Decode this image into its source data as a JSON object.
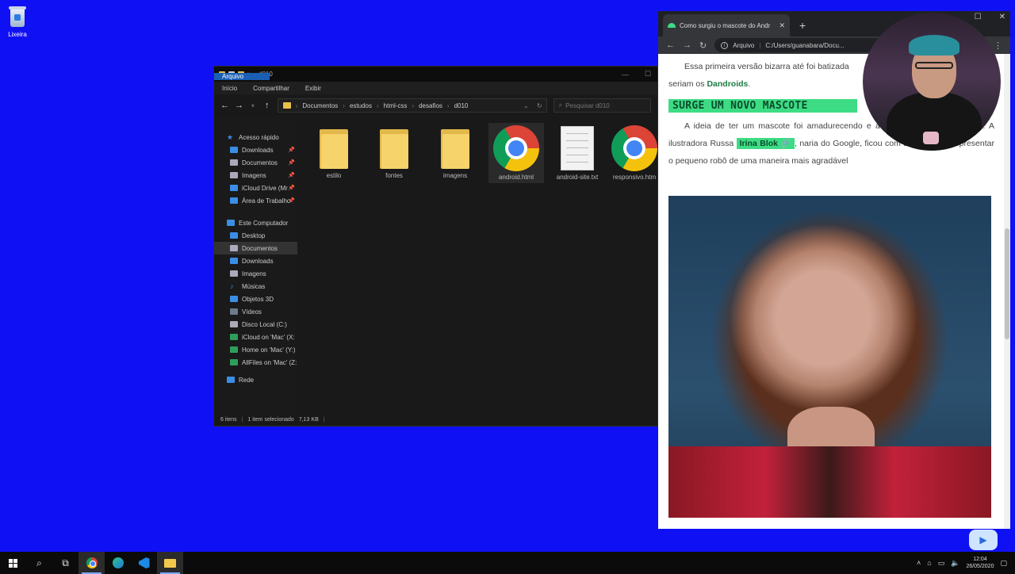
{
  "desktop": {
    "recycle_bin_label": "Lixeira"
  },
  "explorer": {
    "title": "d010",
    "menu": [
      "Arquivo",
      "Início",
      "Compartilhar",
      "Exibir"
    ],
    "breadcrumb": [
      "Documentos",
      "estudos",
      "html-css",
      "desafios",
      "d010"
    ],
    "search_placeholder": "Pesquisar d010",
    "quick_access_label": "Acesso rápido",
    "quick_access": [
      {
        "label": "Downloads",
        "icon": "download-icon"
      },
      {
        "label": "Documentos",
        "icon": "document-icon"
      },
      {
        "label": "Imagens",
        "icon": "image-icon"
      },
      {
        "label": "iCloud Drive (Mr",
        "icon": "cloud-icon"
      },
      {
        "label": "Área de Trabalho",
        "icon": "desktop-icon"
      }
    ],
    "this_pc_label": "Este Computador",
    "this_pc": [
      {
        "label": "Desktop"
      },
      {
        "label": "Documentos"
      },
      {
        "label": "Downloads"
      },
      {
        "label": "Imagens"
      },
      {
        "label": "Músicas"
      },
      {
        "label": "Objetos 3D"
      },
      {
        "label": "Vídeos"
      },
      {
        "label": "Disco Local (C:)"
      },
      {
        "label": "iCloud on 'Mac' (X:"
      },
      {
        "label": "Home on 'Mac' (Y:)"
      },
      {
        "label": "AllFiles on 'Mac' (Z:"
      }
    ],
    "network_label": "Rede",
    "files": [
      {
        "name": "estilo",
        "type": "folder"
      },
      {
        "name": "fontes",
        "type": "folder"
      },
      {
        "name": "imagens",
        "type": "folder"
      },
      {
        "name": "android.html",
        "type": "chrome",
        "selected": true
      },
      {
        "name": "android-site.txt",
        "type": "text"
      },
      {
        "name": "responsivo.htm",
        "type": "chrome"
      }
    ],
    "status": {
      "count": "6 itens",
      "selection": "1 item selecionado",
      "size": "7,13 KB"
    }
  },
  "browser": {
    "tab_title": "Como surgiu o mascote do Andr",
    "omnibox_scheme": "Arquivo",
    "omnibox_url": "C:/Users/guanabara/Docu...",
    "page": {
      "p1_a": "Essa primeira versão bizarra até foi batizada",
      "p1_b": "seriam os",
      "p1_bold": "Dandroids",
      "heading": "SURGE UM NOVO MASCOTE",
      "p2_a": "A ideia de ter um mascote foi amadurecendo e a n",
      "p2_a2": "na",
      "p2_b": "profissional da área. A ilustradora Russa",
      "p2_pill": "Irina Blok",
      "p2_c": "naria do",
      "p2_d": "Google, ficou com a missão de representar o pequeno robô de uma maneira mais agradável"
    }
  },
  "taskbar": {
    "time": "12:04",
    "date": "26/05/2020"
  },
  "colors": {
    "desktop_bg": "#1010f5",
    "android_green": "#3ddc84"
  }
}
